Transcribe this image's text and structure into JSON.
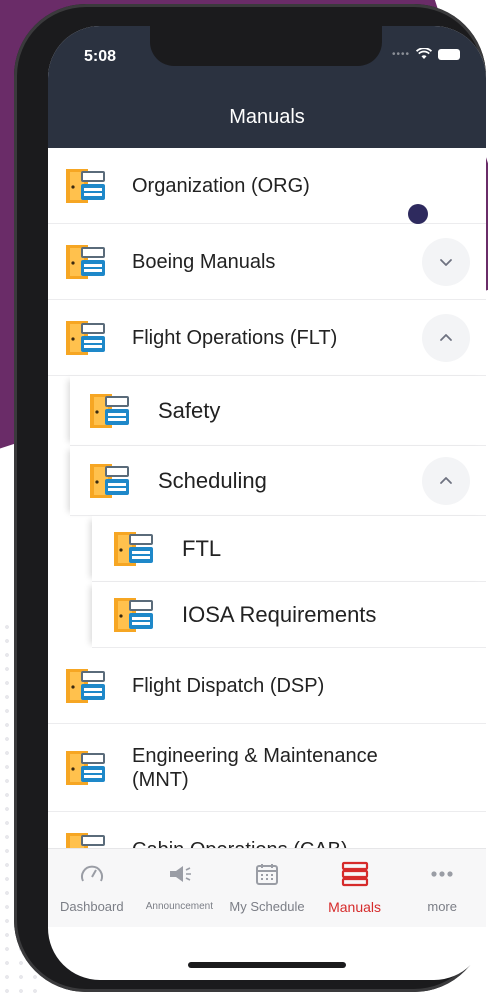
{
  "status": {
    "time": "5:08"
  },
  "header": {
    "title": "Manuals"
  },
  "manuals": [
    {
      "label": "Organization (ORG)",
      "level": 0,
      "chevron": "none"
    },
    {
      "label": "Boeing Manuals",
      "level": 0,
      "chevron": "down"
    },
    {
      "label": "Flight Operations (FLT)",
      "level": 0,
      "chevron": "up"
    },
    {
      "label": "Safety",
      "level": 1,
      "chevron": "none"
    },
    {
      "label": "Scheduling",
      "level": 1,
      "chevron": "up"
    },
    {
      "label": "FTL",
      "level": 2,
      "chevron": "none"
    },
    {
      "label": "IOSA Requirements",
      "level": 2,
      "chevron": "none"
    },
    {
      "label": "Flight Dispatch (DSP)",
      "level": 0,
      "chevron": "none"
    },
    {
      "label": "Engineering & Maintenance (MNT)",
      "level": 0,
      "chevron": "none"
    },
    {
      "label": "Cabin Operations (CAB)",
      "level": 0,
      "chevron": "none"
    }
  ],
  "tabs": [
    {
      "label": "Dashboard",
      "icon": "speedometer-icon",
      "active": false
    },
    {
      "label": "Announcement",
      "icon": "megaphone-icon",
      "active": false
    },
    {
      "label": "My Schedule",
      "icon": "calendar-icon",
      "active": false
    },
    {
      "label": "Manuals",
      "icon": "books-icon",
      "active": true
    },
    {
      "label": "more",
      "icon": "more-icon",
      "active": false
    }
  ],
  "colors": {
    "header_bg": "#2b3240",
    "accent_active": "#d62b2b",
    "background_purple": "#6a2c68"
  }
}
